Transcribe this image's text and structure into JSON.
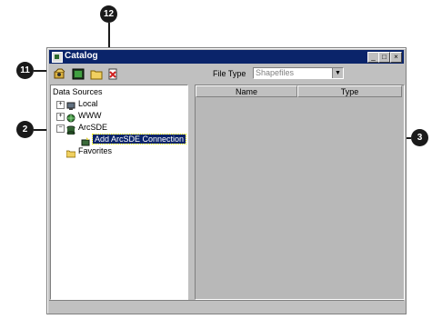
{
  "window": {
    "title": "Catalog"
  },
  "toolbar": {
    "file_type_label": "File Type",
    "file_type_value": "Shapefiles"
  },
  "tree": {
    "root": "Data Sources",
    "items": [
      {
        "label": "Local"
      },
      {
        "label": "WWW"
      },
      {
        "label": "ArcSDE"
      },
      {
        "label": "Add ArcSDE Connection"
      },
      {
        "label": "Favorites"
      }
    ]
  },
  "list": {
    "columns": [
      "Name",
      "Type"
    ]
  },
  "callouts": [
    "11",
    "12",
    "2",
    "3"
  ],
  "icons": [
    "catalog-icon",
    "disconnect-icon",
    "connect-icon",
    "folder-icon",
    "delete-icon",
    "globe-icon",
    "database-icon"
  ]
}
